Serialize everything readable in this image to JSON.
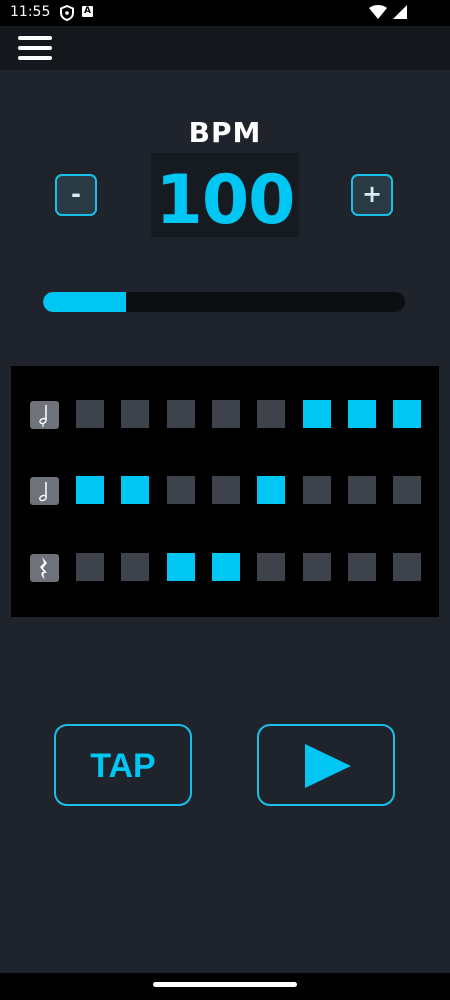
{
  "status_bar": {
    "time": "11:55",
    "icons": [
      "shield-icon",
      "a-badge-icon",
      "wifi-icon",
      "battery-icon"
    ],
    "badge_letter": "A"
  },
  "app_bar": {
    "menu_icon": "hamburger-menu-icon"
  },
  "tempo": {
    "label": "BPM",
    "value": "100",
    "decrement_label": "-",
    "increment_label": "+",
    "slider_fraction": 0.23
  },
  "pattern": {
    "rows": [
      {
        "name": "quarter-note",
        "icon": "quarter-note-icon",
        "cells": [
          0,
          0,
          0,
          0,
          0,
          1,
          1,
          1
        ]
      },
      {
        "name": "half-note",
        "icon": "half-note-icon",
        "cells": [
          1,
          1,
          0,
          0,
          1,
          0,
          0,
          0
        ]
      },
      {
        "name": "rest",
        "icon": "quarter-rest-icon",
        "cells": [
          0,
          0,
          1,
          1,
          0,
          0,
          0,
          0
        ]
      }
    ]
  },
  "controls": {
    "tap_label": "TAP",
    "play_icon": "play-icon"
  },
  "colors": {
    "accent": "#00c6f4",
    "background": "#1f232b",
    "cell_off": "#3d424b",
    "grid_background": "#000000"
  }
}
